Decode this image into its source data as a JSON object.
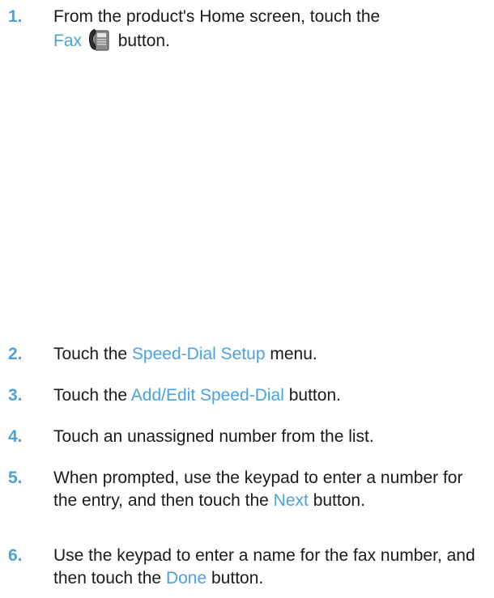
{
  "steps": [
    {
      "number": "1.",
      "parts": [
        "From the product's Home screen, touch the",
        "Fax",
        "button."
      ]
    },
    {
      "number": "2.",
      "parts": [
        "Touch the",
        "Speed-Dial Setup",
        "menu."
      ]
    },
    {
      "number": "3.",
      "parts": [
        "Touch the",
        "Add/Edit Speed-Dial",
        "button."
      ]
    },
    {
      "number": "4.",
      "parts": [
        "Touch an unassigned number from the list."
      ]
    },
    {
      "number": "5.",
      "parts": [
        "When prompted, use the keypad to enter a number for the entry, and then touch the",
        "Next",
        "button."
      ]
    },
    {
      "number": "6.",
      "parts": [
        "Use the keypad to enter a name for the fax number, and then touch the",
        "Done",
        "button."
      ]
    }
  ],
  "icons": {
    "fax_button": "fax-icon"
  },
  "colors": {
    "step_number": "#4aa3de",
    "highlight": "#4aa3de",
    "text": "#1a1a1a"
  }
}
